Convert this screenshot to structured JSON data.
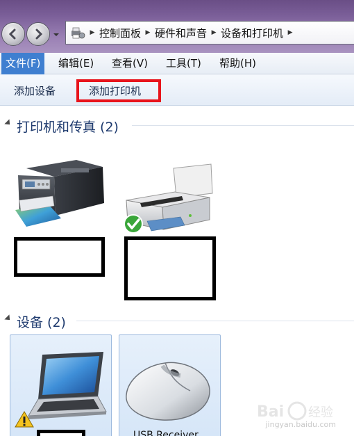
{
  "address_bar": {
    "crumbs": [
      "控制面板",
      "硬件和声音",
      "设备和打印机"
    ]
  },
  "menu": {
    "items": [
      {
        "label": "文件(F)",
        "active": true
      },
      {
        "label": "编辑(E)",
        "active": false
      },
      {
        "label": "查看(V)",
        "active": false
      },
      {
        "label": "工具(T)",
        "active": false
      },
      {
        "label": "帮助(H)",
        "active": false
      }
    ]
  },
  "commands": {
    "add_device": "添加设备",
    "add_printer": "添加打印机"
  },
  "groups": {
    "printers": {
      "title": "打印机和传真 (2)"
    },
    "devices": {
      "title": "设备 (2)"
    }
  },
  "devices": {
    "mouse_name_partial": "USB Receiver"
  },
  "watermark": {
    "text": "jingyan.baidu.com"
  },
  "colors": {
    "titlebar": "#7b5f99",
    "menu_active": "#3f7fd0",
    "highlight_box": "#e8141c",
    "group_title": "#1e3a6e",
    "device_tile": "#dce9f8"
  }
}
